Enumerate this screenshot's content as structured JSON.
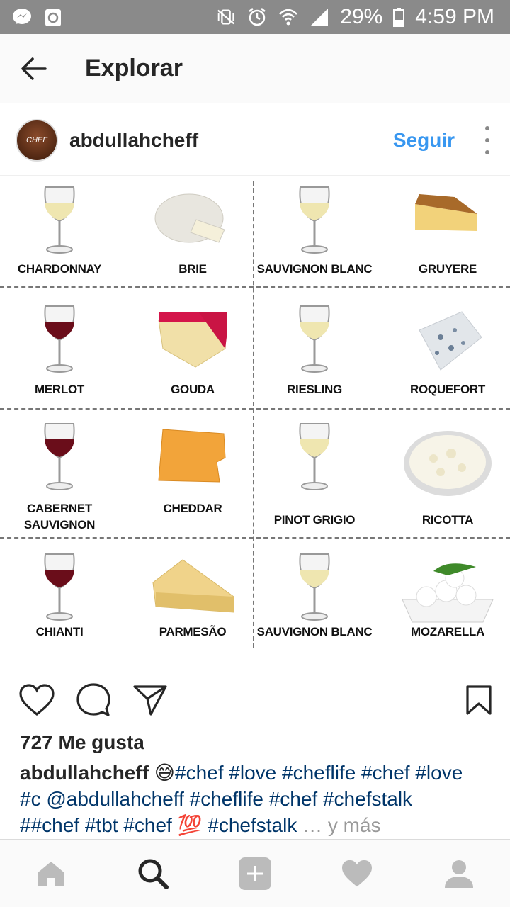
{
  "status_bar": {
    "left_icons": [
      "messenger-icon",
      "recycle-icon"
    ],
    "right_icons": [
      "vibrate-mute-icon",
      "alarm-icon",
      "wifi-icon",
      "signal-icon",
      "battery-icon"
    ],
    "battery": "29%",
    "time": "4:59 PM"
  },
  "header": {
    "back_icon": "arrow-left-icon",
    "title": "Explorar"
  },
  "post": {
    "username": "abdullahcheff",
    "avatar_text": "CHEF",
    "follow_label": "Seguir",
    "more_icon": "more-vertical-icon",
    "pairings": [
      {
        "wine": "CHARDONNAY",
        "wine_type": "white",
        "cheese": "BRIE"
      },
      {
        "wine": "SAUVIGNON BLANC",
        "wine_type": "white",
        "cheese": "GRUYERE"
      },
      {
        "wine": "MERLOT",
        "wine_type": "red",
        "cheese": "GOUDA"
      },
      {
        "wine": "RIESLING",
        "wine_type": "white",
        "cheese": "ROQUEFORT"
      },
      {
        "wine": "CABERNET SAUVIGNON",
        "wine_type": "red",
        "cheese": "CHEDDAR"
      },
      {
        "wine": "PINOT GRIGIO",
        "wine_type": "white",
        "cheese": "RICOTTA"
      },
      {
        "wine": "CHIANTI",
        "wine_type": "red",
        "cheese": "PARMESÃO"
      },
      {
        "wine": "SAUVIGNON BLANC",
        "wine_type": "white",
        "cheese": "MOZARELLA"
      }
    ],
    "likes": "727 Me gusta",
    "caption_user": "abdullahcheff",
    "caption_emoji": "😅",
    "caption_line1": "#chef #love #cheflife #chef #love",
    "caption_line2": "#c @abdullahcheff #cheflife #chef #chefstalk",
    "caption_line3": "##chef #tbt #chef 💯 #chefstalk",
    "caption_more": "… y más"
  },
  "actions": [
    "heart-icon",
    "comment-icon",
    "share-icon",
    "bookmark-icon"
  ],
  "bottom_nav": [
    "home-icon",
    "search-icon",
    "add-icon",
    "activity-heart-icon",
    "profile-icon"
  ],
  "colors": {
    "accent": "#3897f0",
    "hashtag": "#003569",
    "status_bar": "#8a8a8a",
    "red_wine": "#6a0d1a",
    "white_wine": "#efe6b0"
  }
}
